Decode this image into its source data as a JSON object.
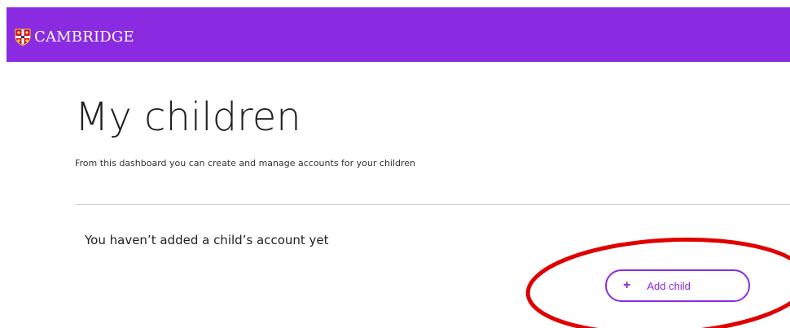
{
  "header": {
    "brand_name": "CAMBRIDGE",
    "brand_color": "#8a2be2",
    "crest_icon": "cambridge-crest-icon"
  },
  "main": {
    "title": "My children",
    "subtitle": "From this dashboard you can create and manage accounts for your children",
    "empty_message": "You haven’t added a child’s account yet"
  },
  "actions": {
    "add_child_label": "Add child",
    "add_child_icon": "plus-icon"
  },
  "annotation": {
    "highlight_color": "#e00000"
  }
}
